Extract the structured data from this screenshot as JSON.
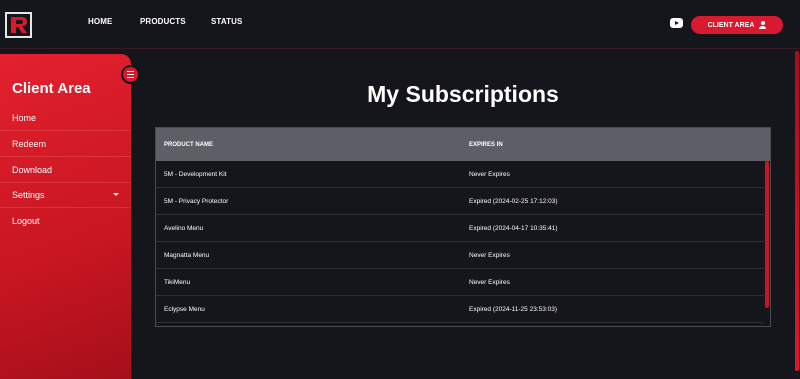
{
  "header": {
    "logo_letter": "R",
    "nav": [
      {
        "label": "HOME"
      },
      {
        "label": "PRODUCTS"
      },
      {
        "label": "STATUS"
      }
    ],
    "client_area_button": "CLIENT AREA",
    "youtube_icon": "youtube-icon",
    "user_icon": "user-icon"
  },
  "sidebar": {
    "title": "Client Area",
    "items": [
      {
        "label": "Home"
      },
      {
        "label": "Redeem"
      },
      {
        "label": "Download"
      },
      {
        "label": "Settings"
      },
      {
        "label": "Logout"
      }
    ],
    "menu_icon": "hamburger-icon"
  },
  "main": {
    "title": "My Subscriptions",
    "table": {
      "headers": [
        "PRODUCT NAME",
        "EXPIRES IN"
      ],
      "rows": [
        [
          "5M - Development Kit",
          "Never Expires"
        ],
        [
          "5M - Privacy Protector",
          "Expired (2024-02-25 17:12:03)"
        ],
        [
          "Avelino Menu",
          "Expired (2024-04-17 10:35:41)"
        ],
        [
          "Magnatta Menu",
          "Never Expires"
        ],
        [
          "TikiMenu",
          "Never Expires"
        ],
        [
          "Eclypse Menu",
          "Expired (2024-11-25 23:53:03)"
        ]
      ]
    }
  },
  "colors": {
    "accent": "#d81a2e",
    "background": "#15151c",
    "table_header": "#5e5e66"
  }
}
